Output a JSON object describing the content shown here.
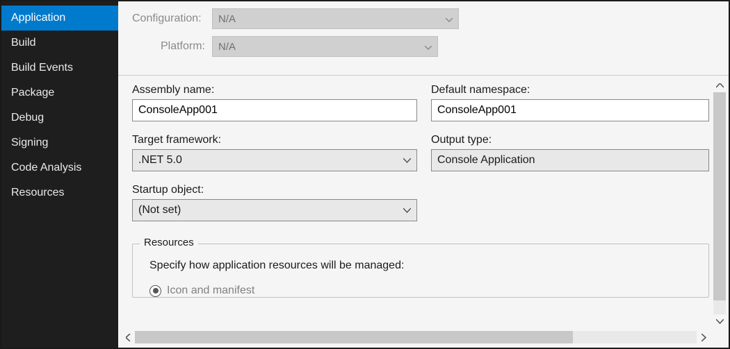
{
  "sidebar": {
    "items": [
      {
        "label": "Application",
        "selected": true
      },
      {
        "label": "Build"
      },
      {
        "label": "Build Events"
      },
      {
        "label": "Package"
      },
      {
        "label": "Debug"
      },
      {
        "label": "Signing"
      },
      {
        "label": "Code Analysis"
      },
      {
        "label": "Resources"
      }
    ]
  },
  "header": {
    "configuration_label": "Configuration:",
    "configuration_value": "N/A",
    "platform_label": "Platform:",
    "platform_value": "N/A"
  },
  "form": {
    "assembly_name_label": "Assembly name:",
    "assembly_name_value": "ConsoleApp001",
    "default_namespace_label": "Default namespace:",
    "default_namespace_value": "ConsoleApp001",
    "target_framework_label": "Target framework:",
    "target_framework_value": ".NET 5.0",
    "output_type_label": "Output type:",
    "output_type_value": "Console Application",
    "startup_object_label": "Startup object:",
    "startup_object_value": "(Not set)"
  },
  "resources_group": {
    "title": "Resources",
    "description": "Specify how application resources will be managed:",
    "radio_label": "Icon and manifest"
  }
}
